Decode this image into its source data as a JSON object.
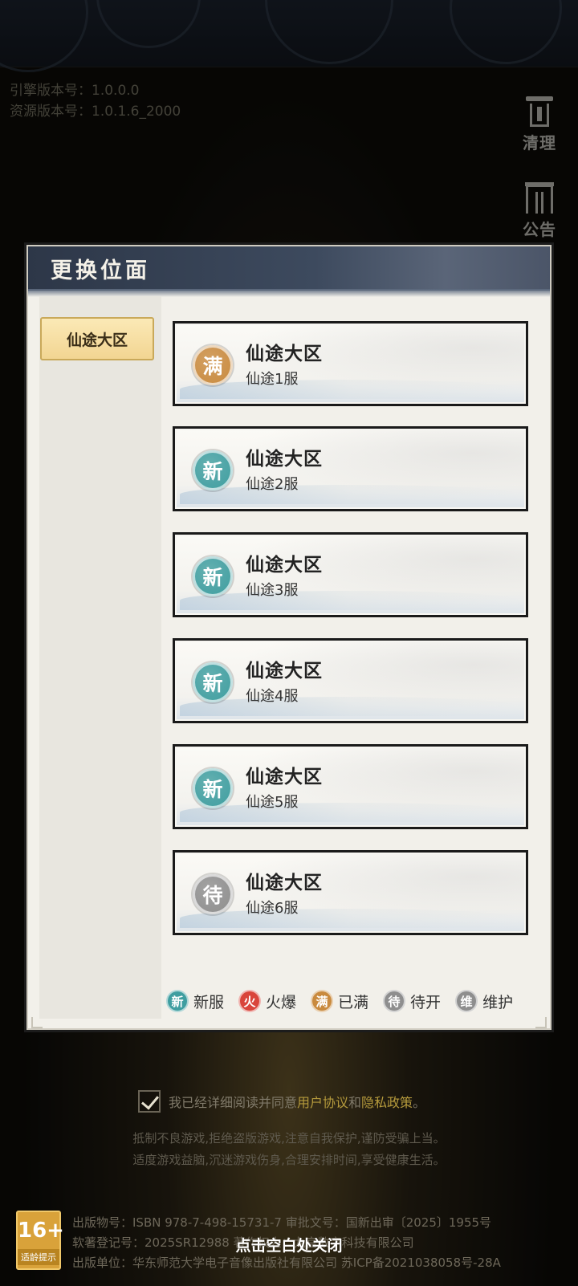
{
  "top": {
    "engine_version": "引擎版本号：1.0.0.0",
    "resource_version": "资源版本号：1.0.1.6_2000",
    "clean_label": "清理",
    "notice_label": "公告"
  },
  "dialog": {
    "title": "更换位面",
    "region_tab": "仙途大区",
    "servers": [
      {
        "badge": "满",
        "badge_color": "#c98a3e",
        "title": "仙途大区",
        "name": "仙途1服"
      },
      {
        "badge": "新",
        "badge_color": "#3f9ea0",
        "title": "仙途大区",
        "name": "仙途2服"
      },
      {
        "badge": "新",
        "badge_color": "#3f9ea0",
        "title": "仙途大区",
        "name": "仙途3服"
      },
      {
        "badge": "新",
        "badge_color": "#3f9ea0",
        "title": "仙途大区",
        "name": "仙途4服"
      },
      {
        "badge": "新",
        "badge_color": "#3f9ea0",
        "title": "仙途大区",
        "name": "仙途5服"
      },
      {
        "badge": "待",
        "badge_color": "#8e8e8e",
        "title": "仙途大区",
        "name": "仙途6服"
      }
    ],
    "legend": [
      {
        "glyph": "新",
        "label": "新服",
        "color": "#3f9ea0"
      },
      {
        "glyph": "火",
        "label": "火爆",
        "color": "#d9453b"
      },
      {
        "glyph": "满",
        "label": "已满",
        "color": "#c98a3e"
      },
      {
        "glyph": "待",
        "label": "待开",
        "color": "#8e8e8e"
      },
      {
        "glyph": "维",
        "label": "维护",
        "color": "#8e8e8e"
      }
    ]
  },
  "bottom": {
    "agree_prefix": "我已经详细阅读并同意",
    "user_agreement": "用户协议",
    "and": "和",
    "privacy": "隐私政策",
    "agree_suffix": "。",
    "notice_line1": "抵制不良游戏,拒绝盗版游戏,注意自我保护,谨防受骗上当。",
    "notice_line2": "适度游戏益脑,沉迷游戏伤身,合理安排时间,享受健康生活。",
    "age_rating": "16+",
    "age_label": "适龄提示",
    "pub_line1": "出版物号：ISBN 978-7-498-15731-7 审批文号：国新出审〔2025〕1955号",
    "pub_line2": "软著登记号：2025SR12988 著作权人：九宫数字科技有限公司",
    "pub_line3": "出版单位：华东师范大学电子音像出版社有限公司 苏ICP备2021038058号-28A",
    "close_hint": "点击空白处关闭"
  }
}
